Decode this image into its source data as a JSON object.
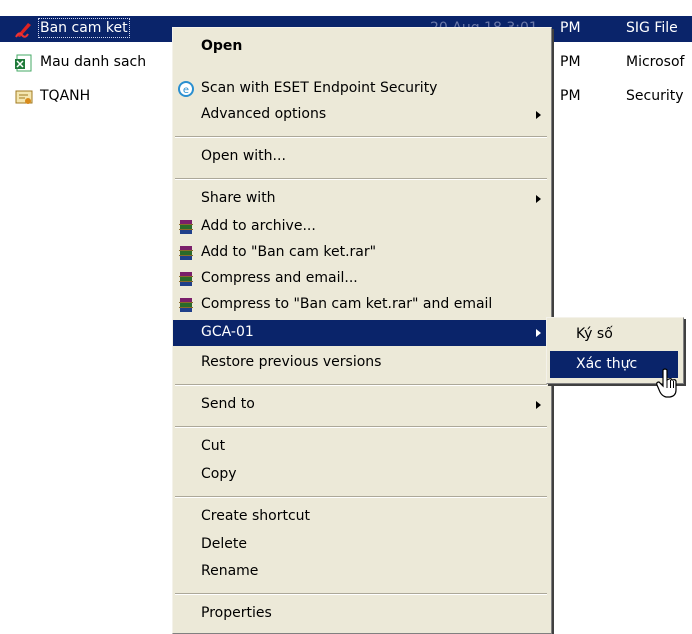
{
  "files": [
    {
      "name": "Ban cam ket",
      "date": "20 Aug 18 3:01",
      "time": "PM",
      "type": "SIG File",
      "icon": "signature-file-icon"
    },
    {
      "name": "Mau danh sach",
      "time": "PM",
      "type": "Microsof",
      "icon": "excel-file-icon"
    },
    {
      "name": "TQANH",
      "time": "PM",
      "type": "Security",
      "icon": "certificate-file-icon"
    }
  ],
  "menu": {
    "open": "Open",
    "scan": "Scan with ESET Endpoint Security",
    "advanced": "Advanced options",
    "open_with": "Open with...",
    "share_with": "Share with",
    "add_archive": "Add to archive...",
    "add_rar": "Add to \"Ban cam ket.rar\"",
    "compress_email": "Compress and email...",
    "compress_rar_email": "Compress to \"Ban cam ket.rar\" and email",
    "gca": "GCA-01",
    "restore": "Restore previous versions",
    "send_to": "Send to",
    "cut": "Cut",
    "copy": "Copy",
    "create_shortcut": "Create shortcut",
    "delete": "Delete",
    "rename": "Rename",
    "properties": "Properties"
  },
  "submenu": {
    "sign": "Ký số",
    "verify": "Xác thực"
  },
  "colors": {
    "highlight": "#0a246a",
    "menu_bg": "#ece9d8"
  }
}
